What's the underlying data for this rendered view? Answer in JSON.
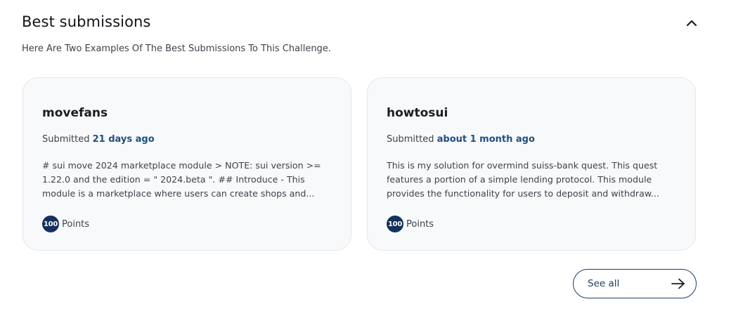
{
  "section": {
    "title": "Best submissions",
    "subtitle": "Here Are Two Examples Of The Best Submissions To This Challenge."
  },
  "submissions": [
    {
      "user": "movefans",
      "submitted_prefix": "Submitted",
      "submitted_when": "21 days ago",
      "description": "# sui move 2024 marketplace module > NOTE: sui version >= 1.22.0 and the edition = \" 2024.beta \". ## Introduce - This module is a marketplace where users can create shops and...",
      "points_value": "100",
      "points_label": "Points"
    },
    {
      "user": "howtosui",
      "submitted_prefix": "Submitted",
      "submitted_when": "about 1 month ago",
      "description": "This is my solution for overmind suiss-bank quest. This quest features a portion of a simple lending protocol. This module provides the functionality for users to deposit and withdraw...",
      "points_value": "100",
      "points_label": "Points"
    }
  ],
  "see_all": {
    "label": "See all"
  },
  "icons": {
    "collapse": "chevron-up-icon",
    "see_all": "arrow-right-icon"
  },
  "colors": {
    "accent": "#1f4f80",
    "badge": "#14315c",
    "card_bg": "#f8f9fb",
    "card_border": "#e4e7ec"
  }
}
